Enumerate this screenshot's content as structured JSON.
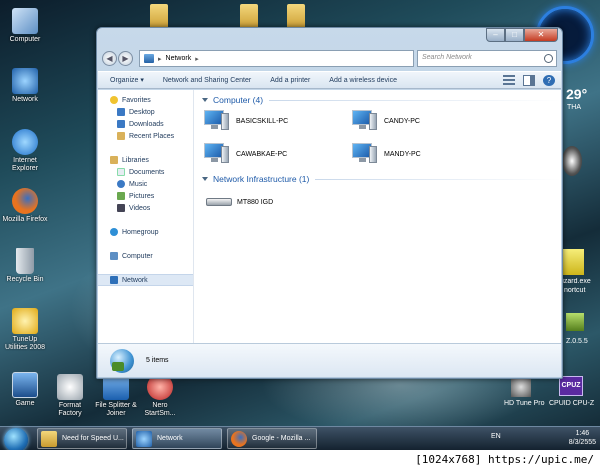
{
  "desktop": {
    "icons": [
      {
        "label": "Computer",
        "color": "#7aa6d3"
      },
      {
        "label": "Network",
        "color": "#3d82c9"
      },
      {
        "label": "Internet Explorer",
        "color": "#2c7fd8"
      },
      {
        "label": "Mozilla Firefox",
        "color": "#e8731f"
      },
      {
        "label": "Recycle Bin",
        "color": "#b8c4cf"
      },
      {
        "label": "TuneUp Utilities 2008",
        "color": "#f2c02a"
      },
      {
        "label": "Game",
        "color": "#3a6fb0"
      }
    ],
    "bottom_icons": [
      {
        "label": "Format Factory",
        "color": "#d3d7db"
      },
      {
        "label": "File Splitter & Joiner",
        "color": "#3b7dc9"
      },
      {
        "label": "Nero StartSm...",
        "color": "#c73030"
      }
    ],
    "right_labels": {
      "temp": "29°",
      "city": "THA",
      "wizard": "rizard.exe",
      "shortcut": "nortcut",
      "zver": "Z.0.5.5",
      "hdtune": "HD Tune Pro",
      "cpuz": "CPUID CPU-Z",
      "cpuz_logo": "CPUZ"
    }
  },
  "window": {
    "address": {
      "location": "Network",
      "separator": "▸"
    },
    "search_placeholder": "Search Network",
    "caption": {
      "min": "–",
      "max": "□",
      "close": "✕"
    },
    "toolbar": {
      "organize": "Organize ▾",
      "sharing_center": "Network and Sharing Center",
      "add_printer": "Add a printer",
      "add_wireless": "Add a wireless device"
    },
    "nav_pane": {
      "favorites": "Favorites",
      "desktop": "Desktop",
      "downloads": "Downloads",
      "recent": "Recent Places",
      "libraries": "Libraries",
      "documents": "Documents",
      "music": "Music",
      "pictures": "Pictures",
      "videos": "Videos",
      "homegroup": "Homegroup",
      "computer": "Computer",
      "network": "Network"
    },
    "groups": {
      "computer": "Computer (4)",
      "infrastructure": "Network Infrastructure (1)"
    },
    "computers": [
      "BASICSKILL-PC",
      "CANDY-PC",
      "CAWABKAE-PC",
      "MANDY-PC"
    ],
    "devices": [
      "MT880 IGD"
    ],
    "status": "5 items"
  },
  "taskbar": {
    "tasks": [
      {
        "label": "Need for Speed U...",
        "color": "#e8b84a"
      },
      {
        "label": "Network",
        "color": "#3d82c9"
      },
      {
        "label": "Google - Mozilla ...",
        "color": "#e8731f"
      }
    ],
    "language": "EN",
    "time": "1:46",
    "date": "8/3/2555"
  },
  "watermark": "[1024x768] https://upic.me/"
}
